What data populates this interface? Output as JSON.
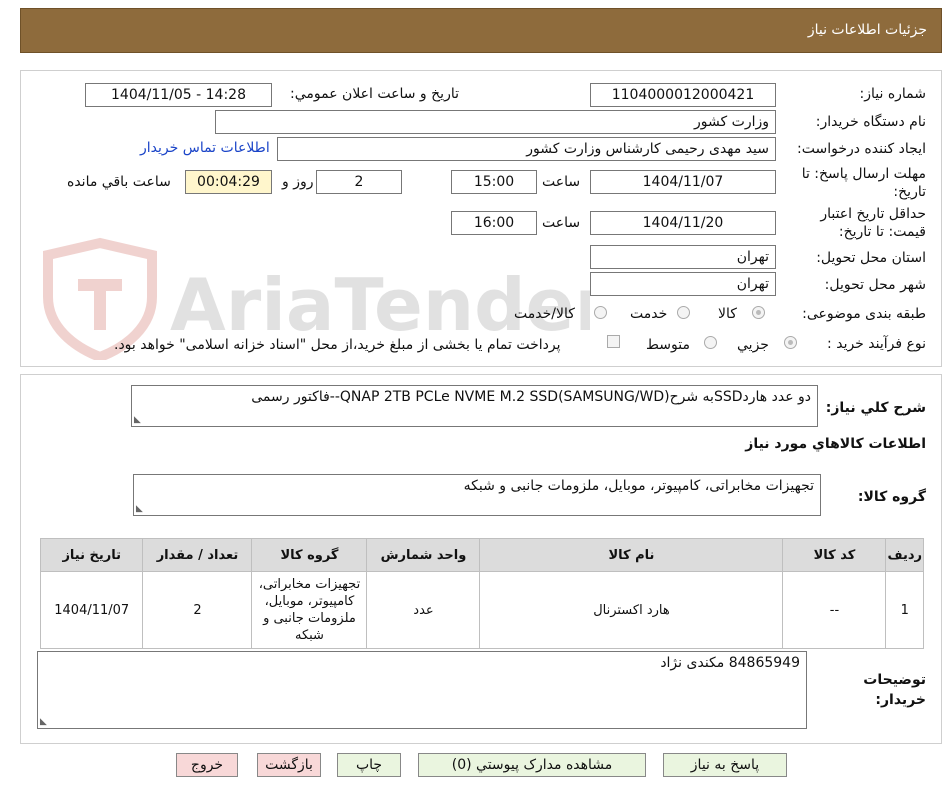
{
  "header": {
    "title": "جزئيات اطلاعات نياز"
  },
  "form": {
    "need_number": {
      "label": "شماره نياز:",
      "value": "1104000012000421"
    },
    "announce_datetime": {
      "label": "تاريخ و ساعت اعلان عمومي:",
      "value": "1404/11/05 - 14:28"
    },
    "buyer_org": {
      "label": "نام دستگاه خريدار:",
      "value": "وزارت کشور"
    },
    "requester": {
      "label": "ايجاد کننده درخواست:",
      "value": "سید مهدی رحیمی کارشناس وزارت کشور"
    },
    "contact_link": "اطلاعات تماس خريدار",
    "reply_deadline": {
      "label1": "مهلت ارسال پاسخ: تا",
      "label2": "تاريخ:",
      "date": "1404/11/07",
      "time_label": "ساعت",
      "time": "15:00",
      "days": "2",
      "days_label": "روز و",
      "remaining": "00:04:29",
      "remaining_label": "ساعت باقي مانده"
    },
    "price_validity": {
      "label1": "حداقل تاريخ اعتبار",
      "label2": "قيمت: تا تاريخ:",
      "date": "1404/11/20",
      "time_label": "ساعت",
      "time": "16:00"
    },
    "province": {
      "label": "استان محل تحويل:",
      "value": "تهران"
    },
    "city": {
      "label": "شهر محل تحويل:",
      "value": "تهران"
    },
    "category": {
      "label": "طبقه بندی موضوعی:",
      "options": [
        "کالا",
        "خدمت",
        "کالا/خدمت"
      ]
    },
    "process_type": {
      "label": "نوع فرآيند خريد :",
      "options": [
        "جزيي",
        "متوسط"
      ],
      "note": "پرداخت تمام يا بخشی از مبلغ خريد،از محل \"اسناد خزانه اسلامی\" خواهد بود."
    }
  },
  "description": {
    "label": "شرح کلي نياز:",
    "value": "دو عدد هاردSSDبه شرحQNAP 2TB PCLe NVME M.2 SSD(SAMSUNG/WD)--فاکتور رسمی"
  },
  "goods_section": {
    "title": "اطلاعات کالاهاي مورد نياز",
    "group_label": "گروه کالا:",
    "group_value": "تجهیزات مخابراتی، کامپیوتر، موبایل، ملزومات جانبی و شبکه"
  },
  "table": {
    "headers": [
      "رديف",
      "کد کالا",
      "نام کالا",
      "واحد شمارش",
      "گروه کالا",
      "تعداد / مقدار",
      "تاريخ نياز"
    ],
    "rows": [
      [
        "1",
        "--",
        "هارد اکسترنال",
        "عدد",
        "تجهیزات مخابراتی، کامپیوتر، موبایل، ملزومات جانبی و شبکه",
        "2",
        "1404/11/07"
      ]
    ]
  },
  "buyer_notes": {
    "label1": "توضيحات",
    "label2": "خريدار:",
    "value": "84865949 مکندی نژاد"
  },
  "buttons": {
    "reply": "پاسخ به نياز",
    "docs": "مشاهده مدارک پيوستي (0)",
    "print": "چاپ",
    "back": "بازگشت",
    "exit": "خروج"
  },
  "watermark": "AriaTender.neT"
}
